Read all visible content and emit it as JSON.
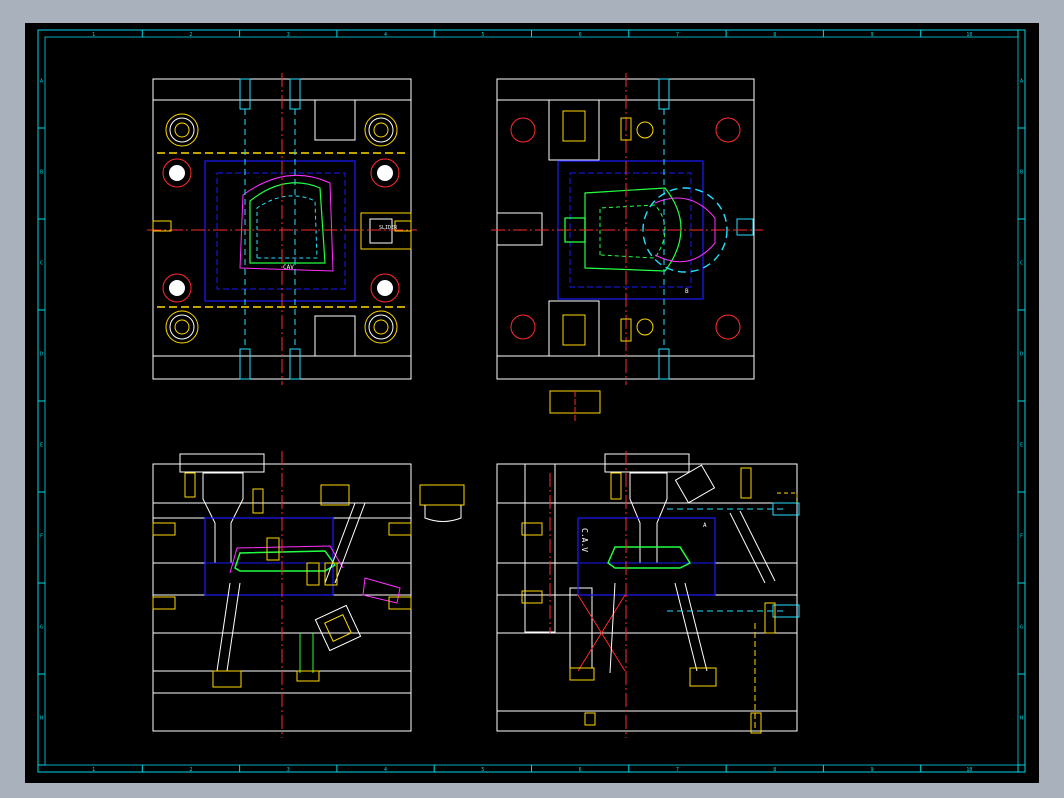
{
  "colors": {
    "background": "#000000",
    "frame": "#00d8e8",
    "outline": "#ffffff",
    "centerline": "#ff2a2a",
    "part_blue": "#1a1aff",
    "part_yellow": "#ffd800",
    "part_cyan": "#24e0ff",
    "part_green": "#22ff44",
    "part_magenta": "#ff30ff",
    "part_pink": "#ff4aa0"
  },
  "border_ticks": {
    "top": [
      "1",
      "2",
      "3",
      "4",
      "5",
      "6",
      "7",
      "8",
      "9",
      "10"
    ],
    "left": [
      "A",
      "B",
      "C",
      "D",
      "E",
      "F",
      "G",
      "H"
    ]
  },
  "labels": {
    "cav_top": "CAV",
    "cav_side": "C.A.V",
    "mark_a": "A",
    "mark_b": "B",
    "slider": "SLIDER"
  }
}
